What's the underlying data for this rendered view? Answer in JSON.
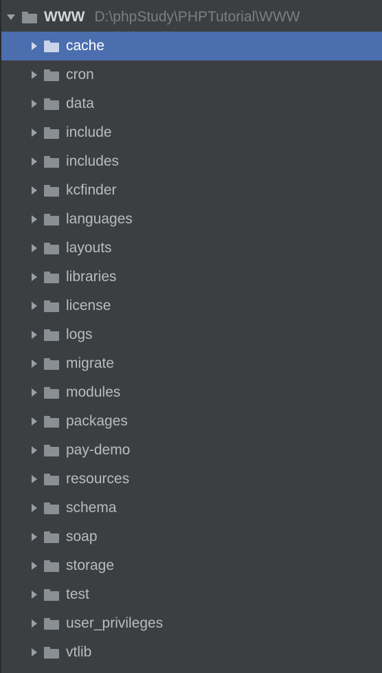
{
  "root": {
    "name": "WWW",
    "path": "D:\\phpStudy\\PHPTutorial\\WWW",
    "expanded": true
  },
  "children": [
    {
      "name": "cache",
      "selected": true
    },
    {
      "name": "cron",
      "selected": false
    },
    {
      "name": "data",
      "selected": false
    },
    {
      "name": "include",
      "selected": false
    },
    {
      "name": "includes",
      "selected": false
    },
    {
      "name": "kcfinder",
      "selected": false
    },
    {
      "name": "languages",
      "selected": false
    },
    {
      "name": "layouts",
      "selected": false
    },
    {
      "name": "libraries",
      "selected": false
    },
    {
      "name": "license",
      "selected": false
    },
    {
      "name": "logs",
      "selected": false
    },
    {
      "name": "migrate",
      "selected": false
    },
    {
      "name": "modules",
      "selected": false
    },
    {
      "name": "packages",
      "selected": false
    },
    {
      "name": "pay-demo",
      "selected": false
    },
    {
      "name": "resources",
      "selected": false
    },
    {
      "name": "schema",
      "selected": false
    },
    {
      "name": "soap",
      "selected": false
    },
    {
      "name": "storage",
      "selected": false
    },
    {
      "name": "test",
      "selected": false
    },
    {
      "name": "user_privileges",
      "selected": false
    },
    {
      "name": "vtlib",
      "selected": false
    }
  ]
}
